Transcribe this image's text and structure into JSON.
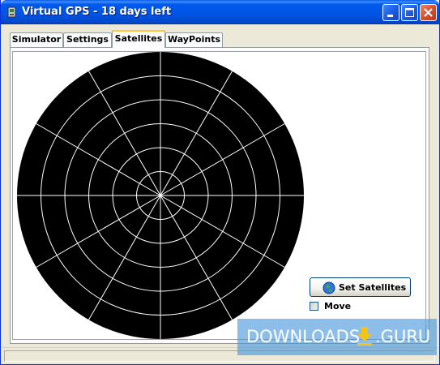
{
  "window": {
    "title": "Virtual GPS - 18 days left",
    "buttons": {
      "minimize": "minimize-icon",
      "maximize": "maximize-icon",
      "close": "close-icon"
    }
  },
  "tabs": [
    {
      "label": "Simulator",
      "active": false
    },
    {
      "label": "Settings",
      "active": false
    },
    {
      "label": "Satellites",
      "active": true
    },
    {
      "label": "WayPoints",
      "active": false
    }
  ],
  "satellites_panel": {
    "sky_plot": {
      "rings": 6,
      "spokes": 12,
      "fill_color": "#000000",
      "line_color": "#ffffff"
    },
    "set_button": {
      "label": "Set Satellites",
      "icon": "globe-icon"
    },
    "move_checkbox": {
      "label": "Move",
      "checked": false
    }
  },
  "watermark": {
    "text_left": "DOWNLOADS",
    "text_right": ".GURU",
    "color": "#4696dc"
  }
}
